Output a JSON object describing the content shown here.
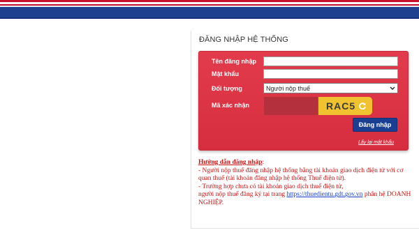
{
  "colors": {
    "banner": "#1f3f8f",
    "banner_stripe": "#c8102e",
    "form_red": "#d62e3f",
    "button_blue": "#1a3f92",
    "captcha_yellow": "#f1c22f",
    "guide_text": "#cc1111",
    "link": "#1a3fd1"
  },
  "login": {
    "title": "ĐĂNG NHẬP HỆ THỐNG",
    "username_label": "Tên đăng nhập",
    "username_value": "",
    "password_label": "Mật khẩu",
    "password_value": "",
    "user_type_label": "Đối tượng",
    "user_type_selected": "Người nộp thuế",
    "captcha_label": "Mã xác nhận",
    "captcha_value": "",
    "captcha_text": "RAC5",
    "submit_label": "Đăng nhập",
    "forgot_password": "Lấy lại mật khẩu"
  },
  "icons": {
    "refresh": "refresh-icon",
    "dropdown": "chevron-down-icon"
  },
  "guide": {
    "title": "Hướng dẫn đăng nhập",
    "title_suffix": ":",
    "line1": "- Người nộp thuế đăng nhập hệ thống bằng tài khoản giao dịch điện tử với cơ quan thuế (tài khoản đăng nhập hệ thống Thuế điện tử).",
    "line2": "- Trường hợp chưa có tài khoản giao dịch thuế điện tử,",
    "line3_prefix": "người nộp thuế đăng ký tại trang ",
    "link_text": "https://thuedientu.gdt.gov.vn",
    "line3_suffix": " phân hệ DOANH NGHIỆP."
  }
}
